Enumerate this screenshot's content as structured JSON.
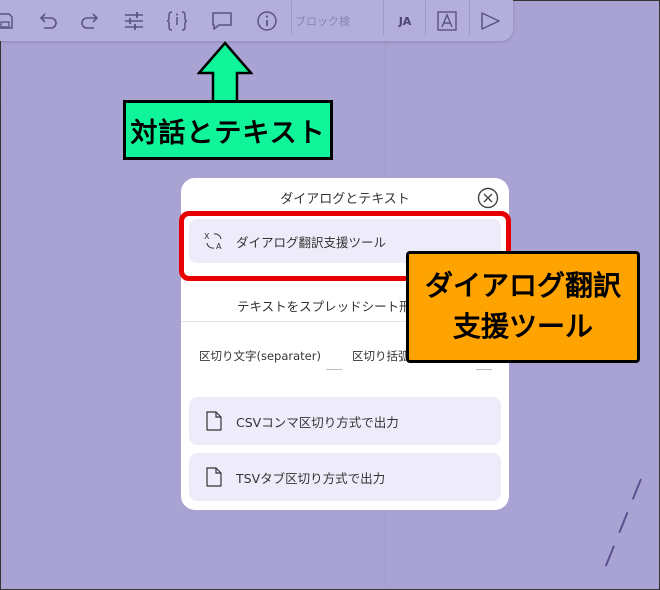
{
  "toolbar": {
    "search_placeholder": "ブロック検",
    "lang_label": "JA",
    "icons": [
      "save-icon",
      "undo-icon",
      "redo-icon",
      "settings-sliders-icon",
      "curly-braces-icon",
      "dialogue-bubble-icon",
      "info-icon",
      "font-icon",
      "play-icon"
    ]
  },
  "callouts": {
    "dialogue": "対話とテキスト",
    "translate_line1": "ダイアログ翻訳",
    "translate_line2": "支援ツール"
  },
  "dialog": {
    "title": "ダイアログとテキスト",
    "translate_item": "ダイアログ翻訳支援ツール",
    "spreadsheet_title": "テキストをスプレッドシート形",
    "separator_label": "区切り文字(separater)",
    "quote_label": "区切り括弧",
    "csv_button": "CSVコンマ区切り方式で出力",
    "tsv_button": "TSVタブ区切り方式で出力"
  },
  "colors": {
    "background": "#a9a3d3",
    "toolbar": "#b4aedc",
    "green_callout": "#11f59a",
    "orange_callout": "#ffa300",
    "highlight": "#e60000",
    "item_bg": "#eeecfa"
  }
}
